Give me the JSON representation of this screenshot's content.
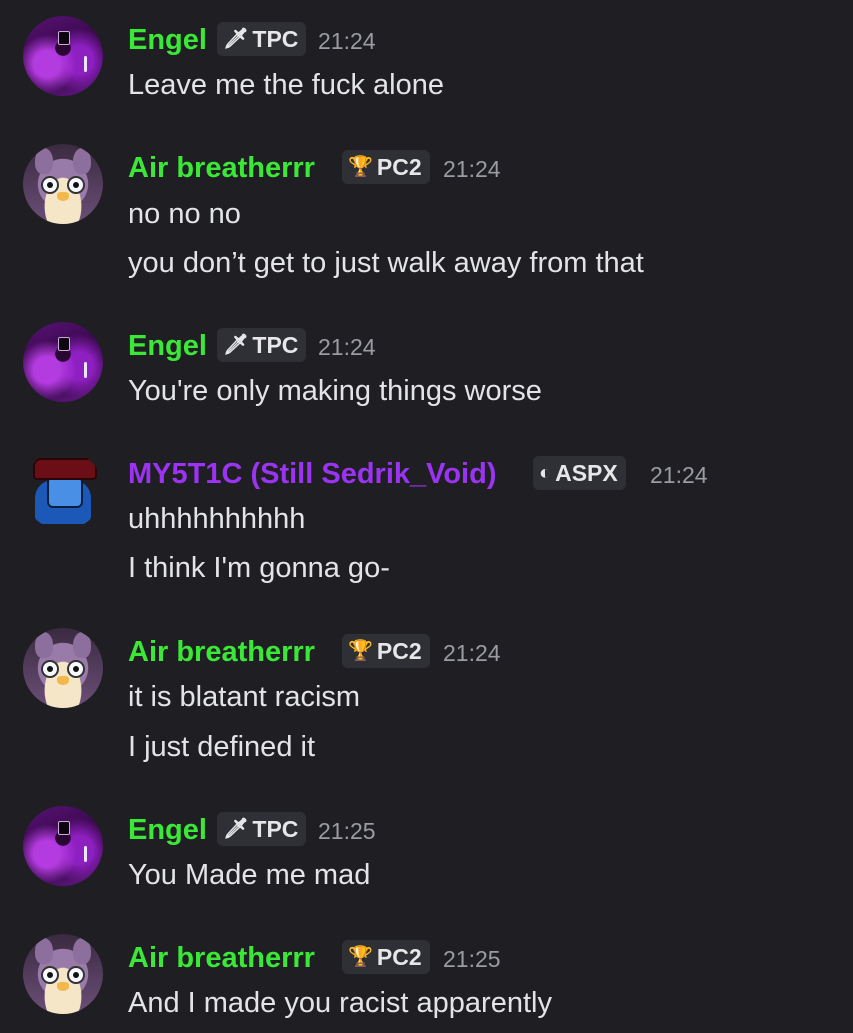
{
  "messages": [
    {
      "author": "Engel",
      "tag": "TPC",
      "tag_icon": "sword-icon",
      "time": "21:24",
      "lines": [
        "Leave me the fuck alone"
      ]
    },
    {
      "author": "Air breatherrr",
      "tag": "PC2",
      "tag_icon": "trophy-icon",
      "time": "21:24",
      "lines": [
        "no no no",
        "you don’t get to just walk away from that"
      ]
    },
    {
      "author": "Engel",
      "tag": "TPC",
      "tag_icon": "sword-icon",
      "time": "21:24",
      "lines": [
        "You're only making things worse"
      ]
    },
    {
      "author": "MY5T1C (Still Sedrik_Void)",
      "tag": "ASPX",
      "tag_icon": "moon-icon",
      "time": "21:24",
      "lines": [
        "uhhhhhhhhhh",
        "I think I'm gonna go-"
      ]
    },
    {
      "author": "Air breatherrr",
      "tag": "PC2",
      "tag_icon": "trophy-icon",
      "time": "21:24",
      "lines": [
        "it is blatant racism",
        "I just defined it"
      ]
    },
    {
      "author": "Engel",
      "tag": "TPC",
      "tag_icon": "sword-icon",
      "time": "21:25",
      "lines": [
        "You Made me mad"
      ]
    },
    {
      "author": "Air breatherrr",
      "tag": "PC2",
      "tag_icon": "trophy-icon",
      "time": "21:25",
      "lines": [
        "And I made you racist apparently"
      ]
    }
  ],
  "colors": {
    "background": "#1f1f23",
    "name_green": "#3be837",
    "name_purple": "#9b34f2",
    "tag_bg": "#2f3035",
    "timestamp": "#9a9ca4"
  }
}
